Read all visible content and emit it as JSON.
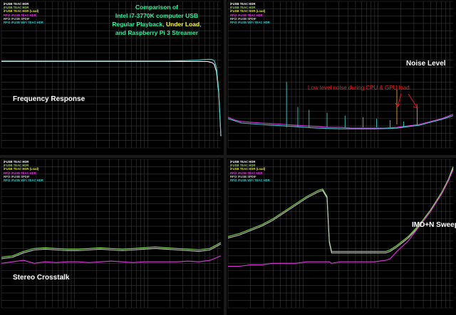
{
  "comparison_title": {
    "line1": "Comparison of",
    "line2": "Intel i7-3770K computer USB",
    "line3a": "Regular Playback, ",
    "line3b": "Under Load",
    "line3c": ",",
    "line4": "and Raspberry Pi 3 Streamer"
  },
  "colors": {
    "series1": "#ffffff",
    "series2": "#7ee04a",
    "series3": "#e8e832",
    "series4": "#e238e2",
    "series5": "#c8c8c8",
    "series6": "#3fc8c8",
    "annotation": "#e02020",
    "grid": "#3a3a3a"
  },
  "legend_labels": [
    "iFUSB TEAC HDR",
    "iFUSB TEAC HDR",
    "iFUSB TEAC HDR (Load)",
    "RPi3 iFUSB TEAC HDR",
    "RPi3 iFUSB SPDIF",
    "RPi3 iFUSB WiFi TEAC HDR"
  ],
  "annotation": "Low level noise during CPU & GPU load.",
  "chart_data": [
    {
      "type": "line",
      "title": "Frequency Response",
      "x": [
        0,
        5,
        10,
        15,
        20,
        25,
        30,
        35,
        40,
        45,
        50,
        55,
        60,
        65,
        70,
        75,
        80,
        85,
        90,
        92,
        94,
        95,
        96,
        97,
        98,
        99,
        100
      ],
      "series": [
        {
          "values": [
            59,
            59,
            59,
            59,
            59,
            59,
            59,
            59,
            59,
            59,
            59,
            59,
            59,
            59,
            59,
            59,
            59,
            59,
            59,
            59,
            59,
            58.6,
            58.2,
            57,
            52,
            38,
            8
          ]
        },
        {
          "values": [
            59.3,
            59.3,
            59.3,
            59.3,
            59.3,
            59.3,
            59.3,
            59.3,
            59.3,
            59.3,
            59.3,
            59.3,
            59.3,
            59.3,
            59.3,
            59.3,
            59.4,
            59.6,
            60,
            60.3,
            60.5,
            60.5,
            60.3,
            59.5,
            55,
            40,
            9
          ]
        }
      ]
    },
    {
      "type": "line",
      "title": "Noise Level",
      "x": [
        0,
        3,
        6,
        10,
        15,
        20,
        25,
        30,
        35,
        40,
        45,
        50,
        55,
        60,
        65,
        70,
        75,
        80,
        85,
        90,
        95,
        100
      ],
      "series": [
        {
          "values": [
            21,
            19,
            18,
            17.5,
            17,
            16.5,
            16,
            15.5,
            15,
            14.5,
            14,
            14,
            13.5,
            13.5,
            13.5,
            13.5,
            14,
            15,
            16,
            18,
            20,
            23
          ]
        },
        {
          "values": [
            20,
            18.5,
            17,
            16.5,
            16,
            15.5,
            15,
            14.5,
            14,
            13.5,
            13.2,
            13,
            13,
            13,
            13,
            13.2,
            13.5,
            14.5,
            15.5,
            17.5,
            19.5,
            22
          ]
        }
      ]
    },
    {
      "type": "line",
      "title": "Stereo Crosstalk",
      "x": [
        0,
        5,
        10,
        15,
        20,
        25,
        30,
        35,
        40,
        45,
        50,
        55,
        60,
        65,
        70,
        75,
        80,
        85,
        90,
        95,
        100
      ],
      "series": [
        {
          "values": [
            34,
            35,
            38,
            40,
            40.5,
            40,
            39.5,
            39.5,
            40,
            40.5,
            40,
            39.5,
            40,
            40.5,
            41,
            40.5,
            40,
            39.5,
            39,
            40,
            44
          ]
        },
        {
          "values": [
            33,
            34,
            37,
            39,
            39.5,
            39,
            38.5,
            38.5,
            39,
            39.5,
            39,
            38.5,
            39,
            39.5,
            40,
            39.5,
            39,
            38.5,
            38,
            39,
            43
          ]
        },
        {
          "values": [
            30,
            31,
            32,
            30,
            31,
            30.5,
            31,
            31,
            30.5,
            31,
            31.5,
            31,
            30.5,
            31,
            31,
            31,
            31,
            31.5,
            31,
            32,
            35
          ]
        }
      ]
    },
    {
      "type": "line",
      "title": "IMD+N Sweep",
      "x": [
        0,
        5,
        10,
        15,
        20,
        25,
        30,
        35,
        40,
        42,
        44,
        45,
        46,
        50,
        55,
        60,
        65,
        70,
        72,
        75,
        80,
        85,
        90,
        95,
        98,
        100
      ],
      "series": [
        {
          "values": [
            48,
            50,
            53,
            56,
            60,
            65,
            70,
            75,
            79,
            80,
            75,
            45,
            38,
            38,
            38,
            38,
            38,
            38,
            39,
            42,
            48,
            56,
            66,
            78,
            87,
            95
          ]
        },
        {
          "values": [
            47,
            49,
            52,
            55,
            59,
            64,
            69,
            74,
            78,
            79,
            74,
            44,
            37,
            37,
            37,
            37,
            37,
            37,
            38,
            41,
            47,
            55,
            65,
            77,
            86,
            94
          ]
        },
        {
          "values": [
            28,
            28,
            29,
            29,
            30,
            30,
            30,
            31,
            31,
            31,
            31,
            31,
            30,
            31,
            31,
            31,
            31,
            32,
            33,
            38,
            45,
            55,
            65,
            77,
            86,
            93
          ]
        }
      ]
    }
  ]
}
